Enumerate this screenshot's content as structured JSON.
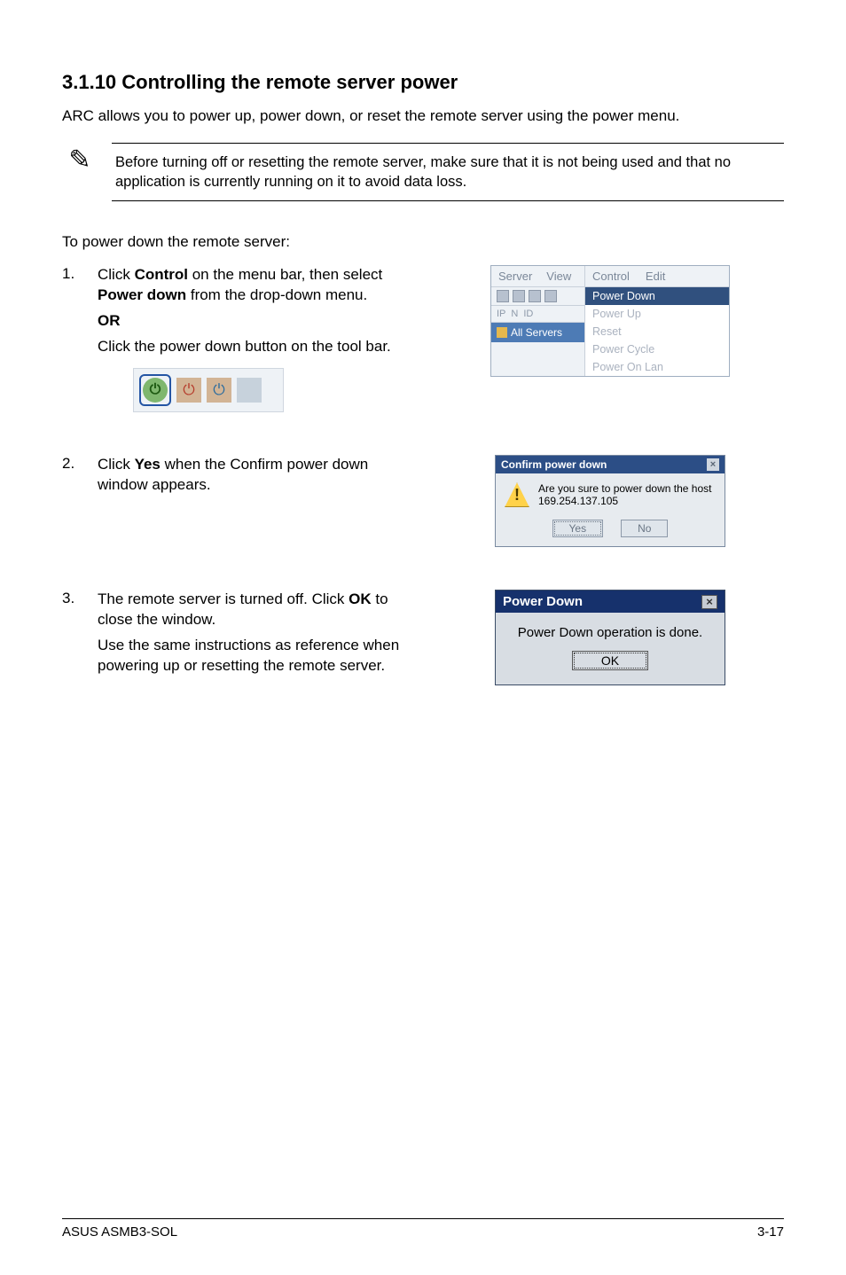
{
  "heading": "3.1.10    Controlling the remote server power",
  "intro": "ARC allows you to power up, power down, or reset the remote server using the power menu.",
  "note": "Before turning off or resetting the remote server, make sure that it is not being used and that no application is currently running on it to avoid data loss.",
  "subintro": "To power down the remote server:",
  "steps": {
    "s1": {
      "num": "1.",
      "l1": "Click Control on the menu bar, then select Power down from the drop-down menu.",
      "or": "OR",
      "l2": "Click the power down button on the tool bar."
    },
    "s2": {
      "num": "2.",
      "text": "Click Yes when the Confirm power down window appears."
    },
    "s3": {
      "num": "3.",
      "l1": "The remote server is turned off. Click OK to close the window.",
      "l2": "Use the same instructions as reference when powering up or resetting the remote server."
    }
  },
  "menu": {
    "top_left": {
      "server": "Server",
      "view": "View"
    },
    "top_right": {
      "control": "Control",
      "edit": "Edit"
    },
    "row2": {
      "ip": "IP",
      "n": "N",
      "id": "ID"
    },
    "tree": "All Servers",
    "items": {
      "power_down": "Power Down",
      "power_up": "Power Up",
      "reset": "Reset",
      "power_cycle": "Power Cycle",
      "power_on_lan": "Power On Lan"
    }
  },
  "confirm": {
    "title": "Confirm power down",
    "msg_l1": "Are you sure to power down the host",
    "msg_l2": "169.254.137.105",
    "yes": "Yes",
    "no": "No"
  },
  "done": {
    "title": "Power Down",
    "msg": "Power Down operation is done.",
    "ok": "OK"
  },
  "footer": {
    "left": "ASUS ASMB3-SOL",
    "right": "3-17"
  }
}
